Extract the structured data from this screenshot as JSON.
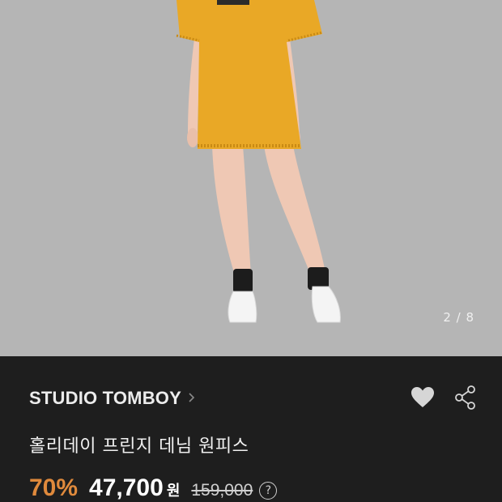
{
  "gallery": {
    "counter": "2 / 8"
  },
  "product": {
    "brand": "STUDIO TOMBOY",
    "title": "홀리데이 프린지 데님 원피스",
    "discount": "70%",
    "price": "47,700",
    "currency": "원",
    "original_price": "159,000",
    "help_icon_glyph": "?"
  },
  "icons": {
    "brand_chevron": "chevron-right-icon",
    "favorite": "heart-icon",
    "share": "share-icon",
    "help": "help-circle-icon"
  },
  "colors": {
    "image_background": "#b5b5b5",
    "panel_background": "#1e1e1e",
    "discount": "#e08a3c",
    "dress": "#e9a826"
  }
}
